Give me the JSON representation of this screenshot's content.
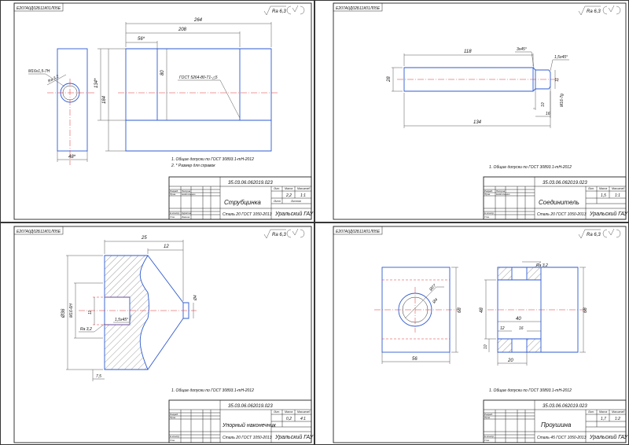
{
  "sheets": [
    {
      "id": "s1",
      "stamp": "Е207А0Д02Б11К01Л05Е",
      "roughness": "Ra 6,3",
      "dims": {
        "d264": "264",
        "d208": "208",
        "d56": "56*",
        "d80": "80",
        "d134": "134*",
        "d184": "184",
        "d48": "48*",
        "thread": "М16х1,5-7Н",
        "ra32": "Ra 3,2",
        "gost": "ГОСТ 5264-80-Т1-△5"
      },
      "notes": [
        "1. Общие допуски по ГОСТ 30893.1-mH-2012",
        "2. * Размер для справок"
      ],
      "tb": {
        "code": "35.03.06.062019.023",
        "name": "Струбцинка",
        "mass": "2,2",
        "scale": "1:1",
        "material": "Сталь 20 ГОСТ 1050-2013",
        "org": "Уральский ГАУ"
      }
    },
    {
      "id": "s2",
      "stamp": "Е207А0Д02Б11К01Л05Е",
      "roughness": "Ra 6,3",
      "dims": {
        "d118": "118",
        "d134": "134",
        "d28": "28",
        "c345": "3х45°",
        "c1545": "1,5х45°",
        "d16": "16",
        "d11": "11",
        "d10": "10",
        "m16": "М16-7g"
      },
      "notes": [
        "1. Общие допуски по ГОСТ 30893.1-mH-2012"
      ],
      "tb": {
        "code": "35.03.06.062019.023",
        "name": "Соединитель",
        "mass": "1,5",
        "scale": "1:1",
        "material": "Сталь 20 ГОСТ 1050-2013",
        "org": "Уральский ГАУ"
      }
    },
    {
      "id": "s3",
      "stamp": "Е207А0Д02Б11К01Л05Е",
      "roughness": "Ra 6,3",
      "dims": {
        "d25": "25",
        "d12": "12",
        "d36": "Ø36",
        "m16": "М16-6Н",
        "d11": "11",
        "c1545": "1,5х45°",
        "ra32": "Ra 3,2",
        "d4": "Ø4",
        "d75": "7,5"
      },
      "notes": [
        "1. Общие допуски по ГОСТ 30893.1-mH-2012"
      ],
      "tb": {
        "code": "35.03.06.062019.023",
        "name": "Упорный наконечник",
        "mass": "0,2",
        "scale": "4:1",
        "material": "Сталь 20 ГОСТ 1050-2013",
        "org": "Уральский ГАУ"
      }
    },
    {
      "id": "s4",
      "stamp": "Е207А0Д02Б11К01Л05Е",
      "roughness": "Ra 6,3",
      "dims": {
        "ra32": "Ra 3,2",
        "d27": "Ø27",
        "d4": "Ø4",
        "d56": "56",
        "d68": "68",
        "d48": "48",
        "d68b": "68",
        "d40": "40",
        "d12": "12",
        "d16": "16",
        "d20": "20",
        "d10": "10"
      },
      "notes": [
        "1. Общие допуски по ГОСТ 30893.1-mH-2012"
      ],
      "tb": {
        "code": "35.03.06.062019.023",
        "name": "Проушина",
        "mass": "1,7",
        "scale": "1:2",
        "material": "Сталь 45 ГОСТ 1050-2013",
        "org": "Уральский ГАУ"
      }
    }
  ],
  "tb_labels": {
    "lit": "Лит.",
    "mass": "Масса",
    "scale": "Масштаб",
    "sheet": "Лист",
    "sheets": "Листов",
    "izm": "Изм",
    "list": "Лист",
    "ndoc": "№ докум.",
    "sign": "Подп.",
    "date": "Дата",
    "razrab": "Разраб.",
    "prov": "Пров.",
    "tkontr": "Т.контр.",
    "nkontr": "Н.контр.",
    "utv": "Утв.",
    "who1": "Петров",
    "who2": "Надточенко",
    "who3": "Курятов",
    "who4": "Иванов"
  }
}
